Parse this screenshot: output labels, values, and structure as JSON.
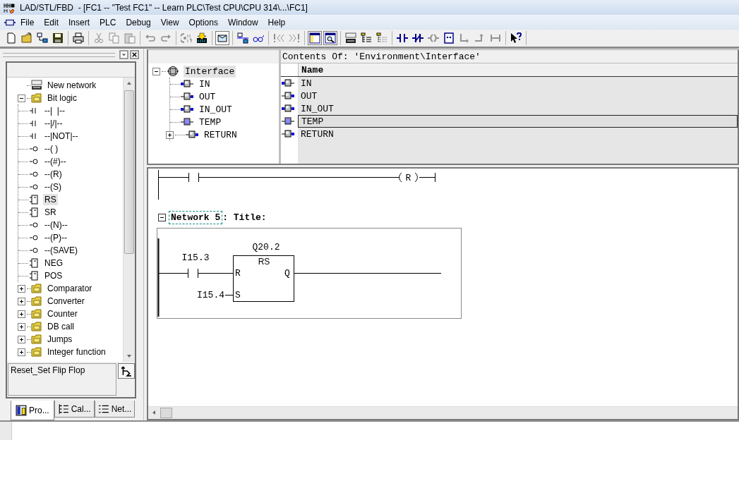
{
  "window": {
    "title": "LAD/STL/FBD  - [FC1 -- \"Test FC1\" -- Learn PLC\\Test CPU\\CPU 314\\...\\FC1]"
  },
  "menu": [
    "File",
    "Edit",
    "Insert",
    "PLC",
    "Debug",
    "View",
    "Options",
    "Window",
    "Help"
  ],
  "toolbar": [
    [
      {
        "disabled": false,
        "pressed": false
      },
      {
        "disabled": false,
        "pressed": false
      },
      {
        "disabled": false,
        "pressed": false
      },
      {
        "disabled": false,
        "pressed": false
      }
    ],
    [
      {
        "disabled": false,
        "pressed": false
      }
    ],
    [
      {
        "disabled": true,
        "pressed": false
      },
      {
        "disabled": true,
        "pressed": false
      },
      {
        "disabled": true,
        "pressed": false
      }
    ],
    [
      {
        "disabled": true,
        "pressed": false
      },
      {
        "disabled": true,
        "pressed": false
      }
    ],
    [
      {
        "disabled": true,
        "pressed": false
      },
      {
        "disabled": false,
        "pressed": false
      }
    ],
    [
      {
        "disabled": false,
        "pressed": true
      }
    ],
    [
      {
        "disabled": false,
        "pressed": false
      },
      {
        "disabled": false,
        "pressed": false
      }
    ],
    [
      {
        "disabled": true,
        "pressed": false
      },
      {
        "disabled": true,
        "pressed": false
      }
    ],
    [
      {
        "disabled": false,
        "pressed": true
      },
      {
        "disabled": false,
        "pressed": true
      }
    ],
    [
      {
        "disabled": false,
        "pressed": false
      },
      {
        "disabled": false,
        "pressed": false
      },
      {
        "disabled": false,
        "pressed": false
      }
    ],
    [
      {
        "disabled": false,
        "pressed": false
      },
      {
        "disabled": false,
        "pressed": false
      },
      {
        "disabled": true,
        "pressed": false
      },
      {
        "disabled": false,
        "pressed": false
      },
      {
        "disabled": true,
        "pressed": false
      },
      {
        "disabled": true,
        "pressed": false
      },
      {
        "disabled": true,
        "pressed": false
      }
    ],
    [
      {
        "disabled": false,
        "pressed": false
      }
    ]
  ],
  "catalog": {
    "items": [
      {
        "label": "New network",
        "kind": "network",
        "selected": false
      },
      {
        "label": "Bit logic",
        "kind": "folder",
        "expanded": true,
        "selected": false,
        "children": [
          {
            "label": "--|  |--",
            "kind": "contact",
            "selected": false
          },
          {
            "label": "--|/|--",
            "kind": "contact",
            "selected": false
          },
          {
            "label": "--|NOT|--",
            "kind": "contact",
            "selected": false
          },
          {
            "label": "--( )",
            "kind": "coil",
            "selected": false
          },
          {
            "label": "--(#)--",
            "kind": "coil",
            "selected": false
          },
          {
            "label": "--(R)",
            "kind": "coil",
            "selected": false
          },
          {
            "label": "--(S)",
            "kind": "coil",
            "selected": false
          },
          {
            "label": "RS",
            "kind": "box",
            "selected": true
          },
          {
            "label": "SR",
            "kind": "box",
            "selected": false
          },
          {
            "label": "--(N)--",
            "kind": "coil",
            "selected": false
          },
          {
            "label": "--(P)--",
            "kind": "coil",
            "selected": false
          },
          {
            "label": "--(SAVE)",
            "kind": "coil",
            "selected": false
          },
          {
            "label": "NEG",
            "kind": "box",
            "selected": false
          },
          {
            "label": "POS",
            "kind": "box",
            "selected": false
          }
        ]
      },
      {
        "label": "Comparator",
        "kind": "folder",
        "expanded": false,
        "selected": false
      },
      {
        "label": "Converter",
        "kind": "folder",
        "expanded": false,
        "selected": false
      },
      {
        "label": "Counter",
        "kind": "folder",
        "expanded": false,
        "selected": false
      },
      {
        "label": "DB call",
        "kind": "folder",
        "expanded": false,
        "selected": false
      },
      {
        "label": "Jumps",
        "kind": "folder",
        "expanded": false,
        "selected": false
      },
      {
        "label": "Integer function",
        "kind": "folder",
        "expanded": false,
        "selected": false
      }
    ],
    "description": "Reset_Set Flip Flop"
  },
  "panel_tabs": [
    {
      "label": "Pro...",
      "selected": true
    },
    {
      "label": "Cal...",
      "selected": false
    },
    {
      "label": "Net...",
      "selected": false
    }
  ],
  "interface_tree": {
    "items": [
      {
        "label": "Interface",
        "kind": "root",
        "expanded": true,
        "selected": true,
        "children": [
          {
            "label": "IN",
            "kind": "in",
            "selected": false
          },
          {
            "label": "OUT",
            "kind": "out",
            "selected": false
          },
          {
            "label": "IN_OUT",
            "kind": "inout",
            "selected": false
          },
          {
            "label": "TEMP",
            "kind": "temp",
            "selected": false
          },
          {
            "label": "RETURN",
            "kind": "return",
            "selected": false,
            "expanded": false
          }
        ]
      }
    ]
  },
  "contents": {
    "header": "Contents Of: 'Environment\\Interface'",
    "column": "Name",
    "rows": [
      {
        "name": "IN",
        "kind": "in",
        "selected": false
      },
      {
        "name": "OUT",
        "kind": "out",
        "selected": false
      },
      {
        "name": "IN_OUT",
        "kind": "inout",
        "selected": false
      },
      {
        "name": "TEMP",
        "kind": "temp",
        "selected": true
      },
      {
        "name": "RETURN",
        "kind": "return",
        "selected": false
      }
    ]
  },
  "editor": {
    "previous_network": {
      "coil": "R"
    },
    "network": {
      "label": "Network 5",
      "title": ": Title:",
      "contact": "I15.3",
      "block_operand": "Q20.2",
      "block_type": "RS",
      "pin_r": "R",
      "pin_q": "Q",
      "pin_s": "S",
      "set_operand": "I15.4"
    }
  }
}
